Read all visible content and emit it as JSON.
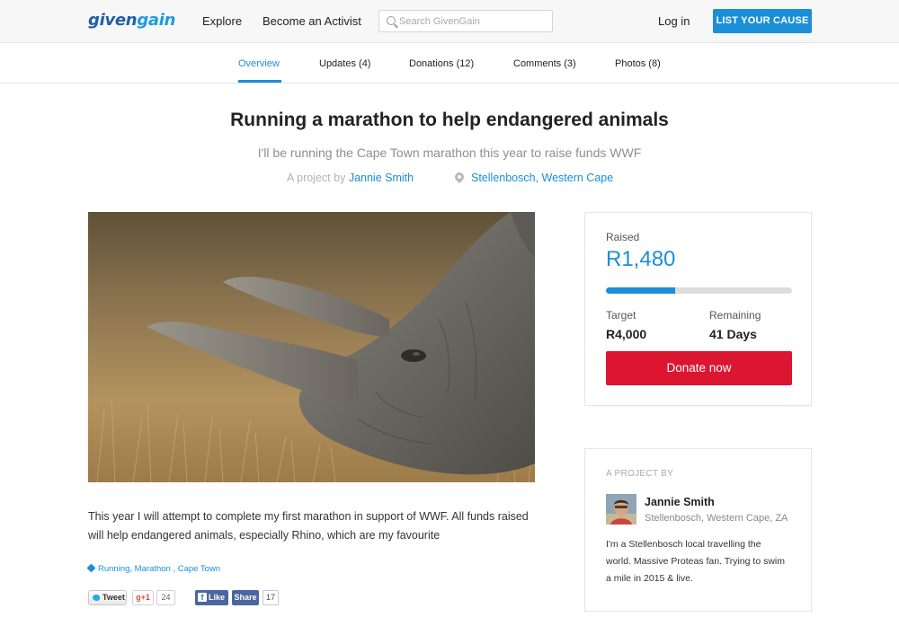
{
  "header": {
    "logo": {
      "part1": "given",
      "part2": "gain"
    },
    "nav": [
      "Explore",
      "Become an Activist"
    ],
    "search_placeholder": "Search GivenGain",
    "login_label": "Log in",
    "cta_label": "LIST YOUR CAUSE"
  },
  "tabs": [
    {
      "label": "Overview",
      "active": true
    },
    {
      "label": "Updates (4)",
      "active": false
    },
    {
      "label": "Donations (12)",
      "active": false
    },
    {
      "label": "Comments (3)",
      "active": false
    },
    {
      "label": "Photos (8)",
      "active": false
    }
  ],
  "project": {
    "title": "Running a marathon to help endangered animals",
    "subtitle": "I'll be running the Cape Town marathon this year to raise funds WWF",
    "byline_prefix": "A project by",
    "author": "Jannie Smith",
    "location": "Stellenbosch, Western Cape",
    "description": "This year I will attempt to complete my first marathon in support of WWF. All funds raised will help endangered animals, especially Rhino, which are my favourite",
    "tags": [
      "Running",
      "Marathon",
      "Cape Town"
    ]
  },
  "social": {
    "tweet_label": "Tweet",
    "gplus_label": "+1",
    "gplus_count": "24",
    "like_label": "Like",
    "share_label": "Share",
    "fb_count": "17"
  },
  "funding": {
    "raised_label": "Raised",
    "raised_amount": "R1,480",
    "progress_fraction": 0.37,
    "target_label": "Target",
    "target_value": "R4,000",
    "remaining_label": "Remaining",
    "remaining_value": "41 Days",
    "donate_label": "Donate now"
  },
  "owner": {
    "heading": "A PROJECT BY",
    "name": "Jannie Smith",
    "location": "Stellenbosch, Western Cape, ZA",
    "bio": "I'm a Stellenbosch local travelling the world. Massive Proteas fan. Trying to swim a mile in 2015 & live."
  },
  "colors": {
    "accent": "#1a8fd8",
    "donate": "#dc1531",
    "logo_dark": "#1e5fa8"
  },
  "icons": [
    "search-icon",
    "location-pin-icon",
    "tag-icon",
    "twitter-bird-icon",
    "facebook-icon"
  ]
}
